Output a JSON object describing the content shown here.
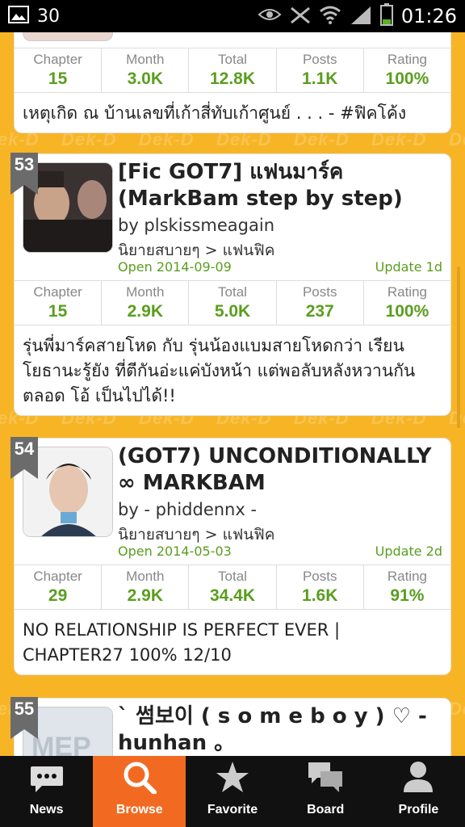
{
  "status_bar": {
    "notification_count": "30",
    "time": "01:26"
  },
  "stat_labels": [
    "Chapter",
    "Month",
    "Total",
    "Posts",
    "Rating"
  ],
  "watermark_text": "Dek-D",
  "cards": [
    {
      "stats": [
        "15",
        "3.0K",
        "12.8K",
        "1.1K",
        "100%"
      ],
      "description": "เหตุเกิด ณ บ้านเลขที่เก้าสี่ทับเก้าศูนย์ . . . - #ฟิคโค้ง"
    },
    {
      "rank": "53",
      "title": "[Fic GOT7] แฟนมาร์ค (MarkBam step by step)",
      "author": "by plskissmeagain",
      "category": "นิยายสบายๆ > แฟนฟิค",
      "open": "Open 2014-09-09",
      "update": "Update 1d",
      "stats": [
        "15",
        "2.9K",
        "5.0K",
        "237",
        "100%"
      ],
      "description": "รุ่นพี่มาร์คสายโหด กับ รุ่นน้องแบมสายโหดกว่า เรียนโยธานะรู้ยัง ที่ตีกันอ่ะแค่บังหน้า แต่พอลับหลังหวานกันตลอด โอ้ เป็นไปได้!!"
    },
    {
      "rank": "54",
      "title": "(GOT7) UNCONDITIONALLY ∞ MARKBAM",
      "author": "by - phiddennx -",
      "category": "นิยายสบายๆ > แฟนฟิค",
      "open": "Open 2014-05-03",
      "update": "Update 2d",
      "stats": [
        "29",
        "2.9K",
        "34.4K",
        "1.6K",
        "91%"
      ],
      "description": "NO RELATIONSHIP IS PERFECT EVER | CHAPTER27 100% 12/10"
    },
    {
      "rank": "55",
      "title": "` 썸보이 ( s o m e b o y ) ♡ - hunhan 。"
    }
  ],
  "nav": [
    {
      "label": "News",
      "icon": "speech-bubble-icon"
    },
    {
      "label": "Browse",
      "icon": "search-icon",
      "active": true
    },
    {
      "label": "Favorite",
      "icon": "star-icon"
    },
    {
      "label": "Board",
      "icon": "chat-bubbles-icon"
    },
    {
      "label": "Profile",
      "icon": "person-icon"
    }
  ],
  "colors": {
    "background": "#f7b526",
    "accent_green": "#5a9e1e",
    "active_tab": "#f26a21",
    "nav_bg": "#111111"
  }
}
